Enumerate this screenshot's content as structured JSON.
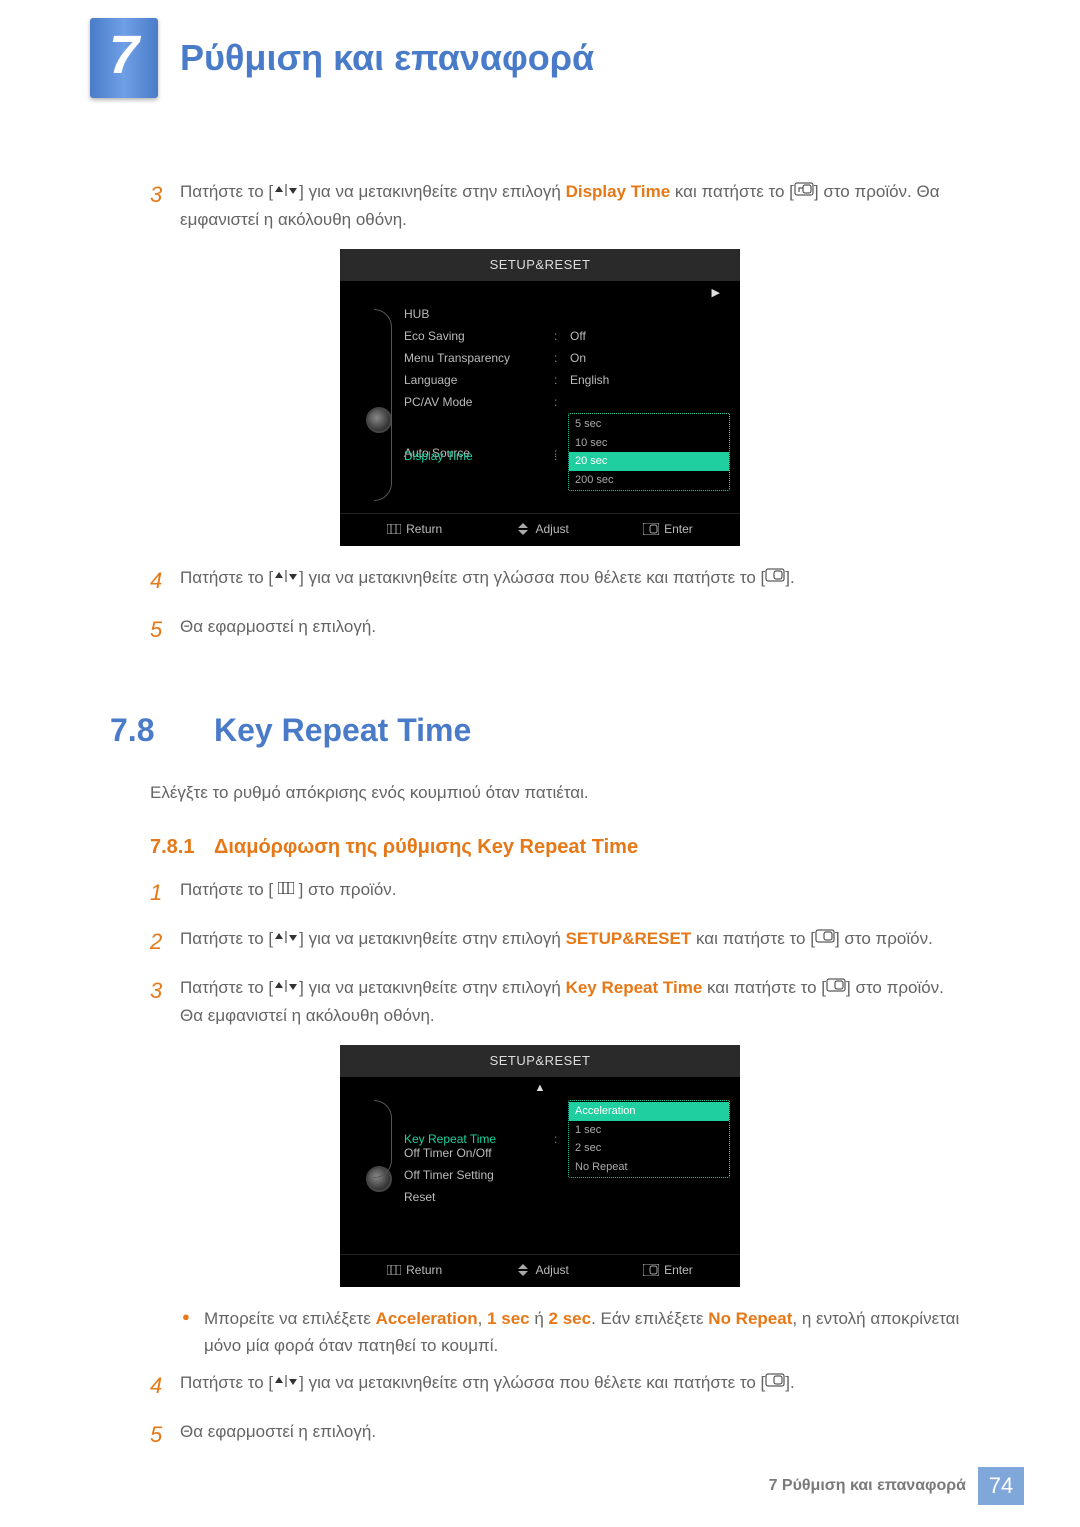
{
  "header": {
    "chapter_number": "7",
    "chapter_title": "Ρύθμιση και επαναφορά"
  },
  "steps_top": {
    "3": {
      "before": "Πατήστε το [",
      "mid": "] για να μετακινηθείτε στην επιλογή ",
      "hl": "Display Time",
      "mid2": " και πατήστε το [",
      "after": "] στο προϊόν. Θα εμφανιστεί η ακόλουθη οθόνη."
    },
    "4": {
      "before": "Πατήστε το [",
      "mid": "] για να μετακινηθείτε στη γλώσσα που θέλετε και πατήστε το [",
      "after": "]."
    },
    "5": "Θα εφαρμοστεί η επιλογή."
  },
  "osd1": {
    "title": "SETUP&RESET",
    "rows": [
      {
        "label": "HUB",
        "value": ""
      },
      {
        "label": "Eco Saving",
        "value": "Off"
      },
      {
        "label": "Menu Transparency",
        "value": "On"
      },
      {
        "label": "Language",
        "value": "English"
      },
      {
        "label": "PC/AV Mode",
        "value": ""
      },
      {
        "label": "Auto Source",
        "value": ""
      }
    ],
    "active_label": "Display Time",
    "options": [
      "5 sec",
      "10 sec",
      "20 sec",
      "200 sec"
    ],
    "selected": "20 sec",
    "footer": {
      "return": "Return",
      "adjust": "Adjust",
      "enter": "Enter"
    }
  },
  "section": {
    "num": "7.8",
    "title": "Key Repeat Time",
    "desc": "Ελέγξτε το ρυθμό απόκρισης ενός κουμπιού όταν πατιέται."
  },
  "subsection": {
    "num": "7.8.1",
    "title": "Διαμόρφωση της ρύθμισης Key Repeat Time"
  },
  "steps_bottom": {
    "1": {
      "before": "Πατήστε το [ ",
      "after": " ] στο προϊόν."
    },
    "2": {
      "before": "Πατήστε το [",
      "mid": "] για να μετακινηθείτε στην επιλογή ",
      "hl": "SETUP&RESET",
      "mid2": " και πατήστε το [",
      "after": "] στο προϊόν."
    },
    "3": {
      "before": "Πατήστε το [",
      "mid": "] για να μετακινηθείτε στην επιλογή ",
      "hl": "Key Repeat Time",
      "mid2": " και πατήστε το [",
      "after": "] στο προϊόν. Θα εμφανιστεί η ακόλουθη οθόνη."
    },
    "4": {
      "before": "Πατήστε το [",
      "mid": "] για να μετακινηθείτε στη γλώσσα που θέλετε και πατήστε το [",
      "after": "]."
    },
    "5": "Θα εφαρμοστεί η επιλογή."
  },
  "osd2": {
    "title": "SETUP&RESET",
    "active_label": "Key Repeat Time",
    "rows": [
      {
        "label": "Off Timer On/Off"
      },
      {
        "label": "Off Timer Setting"
      },
      {
        "label": "Reset"
      }
    ],
    "options": [
      "Acceleration",
      "1 sec",
      "2 sec",
      "No Repeat"
    ],
    "selected": "Acceleration",
    "footer": {
      "return": "Return",
      "adjust": "Adjust",
      "enter": "Enter"
    }
  },
  "bullet": {
    "t1": "Μπορείτε να επιλέξετε ",
    "hl1": "Acceleration",
    "t2": ", ",
    "hl2": "1 sec",
    "t3": " ή ",
    "hl3": "2 sec",
    "t4": ". Εάν επιλέξετε ",
    "hl4": "No Repeat",
    "t5": ", η εντολή αποκρίνεται μόνο μία φορά όταν πατηθεί το κουμπί."
  },
  "footer": {
    "text": "7 Ρύθμιση και επαναφορά",
    "page": "74"
  }
}
